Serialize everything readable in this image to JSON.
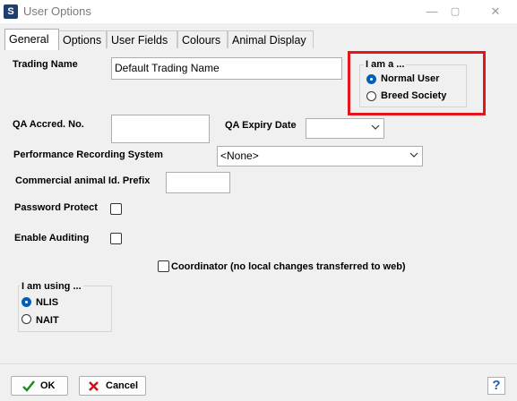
{
  "window": {
    "title": "User Options",
    "icon_letter": "S",
    "minimize_glyph": "—",
    "maximize_glyph": "▢",
    "close_glyph": "✕"
  },
  "tabs": [
    {
      "label": "General",
      "active": true
    },
    {
      "label": "Options"
    },
    {
      "label": "User Fields"
    },
    {
      "label": "Colours"
    },
    {
      "label": "Animal Display"
    }
  ],
  "general": {
    "trading_name": {
      "label": "Trading Name",
      "value": "Default Trading Name"
    },
    "qa_accred": {
      "label": "QA Accred. No.",
      "value": ""
    },
    "qa_expiry": {
      "label": "QA Expiry Date",
      "value": ""
    },
    "performance_recording": {
      "label": "Performance Recording System",
      "value": "<None>"
    },
    "commercial_prefix": {
      "label": "Commercial animal Id. Prefix",
      "value": ""
    },
    "password_protect": {
      "label": "Password Protect",
      "checked": false
    },
    "enable_auditing": {
      "label": "Enable Auditing",
      "checked": false
    },
    "coordinator": {
      "label": "Coordinator (no local changes transferred to web)",
      "checked": false
    },
    "i_am_a": {
      "title": "I am a ...",
      "options": [
        {
          "label": "Normal User",
          "selected": true
        },
        {
          "label": "Breed Society",
          "selected": false
        }
      ]
    },
    "i_am_using": {
      "title": "I am using ...",
      "options": [
        {
          "label": "NLIS",
          "selected": true
        },
        {
          "label": "NAIT",
          "selected": false
        }
      ]
    }
  },
  "footer": {
    "ok_label": "OK",
    "cancel_label": "Cancel",
    "help_glyph": "?"
  },
  "colors": {
    "highlight": "#e5161b",
    "radio_selected": "#005fb8",
    "ok_check": "#1a8c1a",
    "cancel_x": "#c0181b"
  }
}
